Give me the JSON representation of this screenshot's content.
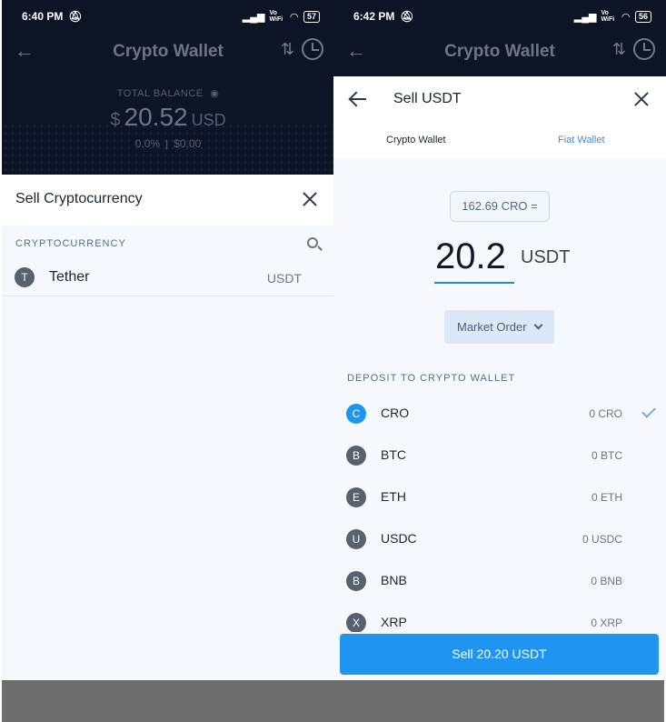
{
  "left": {
    "status": {
      "time": "6:40 PM",
      "alarm_icon": "bell-off-icon",
      "signal": "signal-icon",
      "volte": "Vo WiFi",
      "wifi": "wifi-icon",
      "battery": "57"
    },
    "header": {
      "title": "Crypto Wallet"
    },
    "balance": {
      "label": "TOTAL BALANCE",
      "currency_symbol": "$",
      "amount": "20.52",
      "unit": "USD",
      "change_pct": "0.0%",
      "change_abs": "$0.00"
    },
    "sheet": {
      "title": "Sell Cryptocurrency"
    },
    "list": {
      "section_label": "CRYPTOCURRENCY",
      "items": [
        {
          "icon_letter": "T",
          "name": "Tether",
          "symbol": "USDT"
        }
      ]
    }
  },
  "right": {
    "status": {
      "time": "6:42 PM",
      "alarm_icon": "bell-off-icon",
      "signal": "signal-icon",
      "volte": "Vo WiFi",
      "wifi": "wifi-icon",
      "battery": "56"
    },
    "header": {
      "title": "Crypto Wallet"
    },
    "sheet": {
      "title": "Sell USDT"
    },
    "tabs": [
      {
        "label": "Crypto Wallet",
        "active": true
      },
      {
        "label": "Fiat Wallet",
        "active": false
      }
    ],
    "conversion": {
      "text": "162.69 CRO ="
    },
    "amount": {
      "value": "20.2",
      "unit": "USDT"
    },
    "order_type": {
      "label": "Market Order"
    },
    "deposit": {
      "section_label": "DEPOSIT TO CRYPTO WALLET",
      "items": [
        {
          "letter": "C",
          "name": "CRO",
          "balance": "0 CRO",
          "selected": true
        },
        {
          "letter": "B",
          "name": "BTC",
          "balance": "0 BTC",
          "selected": false
        },
        {
          "letter": "E",
          "name": "ETH",
          "balance": "0 ETH",
          "selected": false
        },
        {
          "letter": "U",
          "name": "USDC",
          "balance": "0 USDC",
          "selected": false
        },
        {
          "letter": "B",
          "name": "BNB",
          "balance": "0 BNB",
          "selected": false
        },
        {
          "letter": "X",
          "name": "XRP",
          "balance": "0 XRP",
          "selected": false
        }
      ]
    },
    "sell_button": {
      "label": "Sell 20.20 USDT"
    }
  },
  "colors": {
    "header_bg": "#0c1426",
    "accent": "#1f94f0",
    "sheet_bg": "#f5f8fc"
  }
}
